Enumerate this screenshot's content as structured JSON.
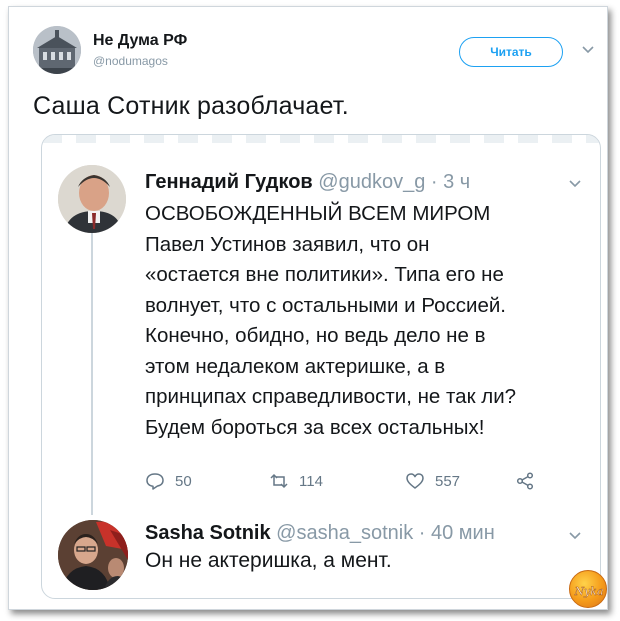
{
  "outer_tweet": {
    "author_name": "Не Дума РФ",
    "author_handle": "@nodumagos",
    "follow_label": "Читать",
    "text": "Саша Сотник разоблачает."
  },
  "quoted_thread": {
    "tweet1": {
      "author_name": "Геннадий Гудков",
      "author_handle": "@gudkov_g · 3 ч",
      "text": "ОСВОБОЖДЕННЫЙ ВСЕМ МИРОМ\nПавел Устинов заявил, что он\n«остается вне политики». Типа его не\nволнует, что с остальными и Россией.\nКонечно, обидно, но ведь дело не в\nэтом недалеком актеришке, а в\nпринципах справедливости, не так ли?\nБудем бороться за всех остальных!",
      "actions": {
        "replies": "50",
        "retweets": "114",
        "likes": "557"
      }
    },
    "tweet2": {
      "author_name": "Sasha Sotnik",
      "author_handle": "@sasha_sotnik · 40 мин",
      "text": "Он не актеришка, а мент."
    }
  },
  "colors": {
    "accent": "#1da1f2",
    "muted": "#8899a6",
    "text": "#14171a",
    "border": "#ccd6dd"
  },
  "icons": [
    "chevron-down-icon",
    "reply-icon",
    "retweet-icon",
    "like-icon",
    "share-icon"
  ],
  "watermark": {
    "text": "Nyka"
  }
}
